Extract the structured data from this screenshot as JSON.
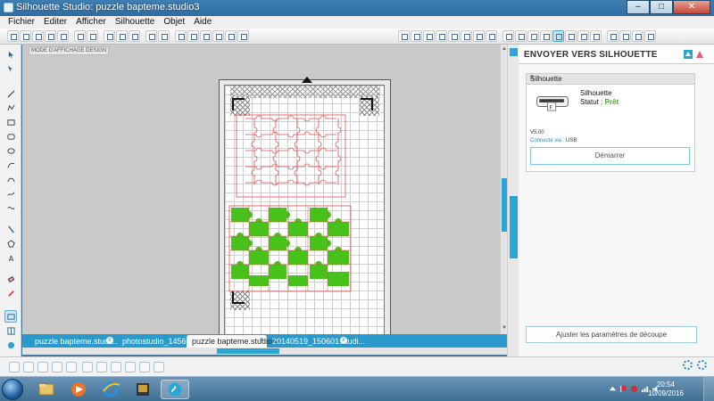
{
  "window": {
    "title": "Silhouette Studio: puzzle bapteme.studio3",
    "minimize": "–",
    "maximize": "□",
    "close": "✕"
  },
  "menu": [
    "Fichier",
    "Editer",
    "Afficher",
    "Silhouette",
    "Objet",
    "Aide"
  ],
  "canvas": {
    "mode_label": "MODE D'AFFICHAGE DESIGN"
  },
  "tabs": [
    {
      "label": "puzzle bapteme.studi...",
      "active": false
    },
    {
      "label": "photostudio_145644...",
      "active": false
    },
    {
      "label": "puzzle bapteme.studio3",
      "active": true
    },
    {
      "label": "20140519_150601.studi...",
      "active": false
    }
  ],
  "panel": {
    "title": "ENVOYER VERS SILHOUETTE",
    "device_section": "Silhouette",
    "device_name": "Silhouette",
    "status_label": "Statut : ",
    "status_value": "Prêt",
    "version": "V5.00",
    "connection_label": "Connecté via : ",
    "connection_value": "USB",
    "start_button": "Démarrer",
    "adjust_button": "Ajuster les paramètres de découpe",
    "pause_symbol": "II",
    "cutter_letter": "F"
  },
  "taskbar": {
    "time": "20:54",
    "date": "10/09/2016"
  },
  "colors": {
    "accent": "#2aa6d6",
    "puzzle_outline": "#e04b4b",
    "puzzle_fill": "#47c21a",
    "status_ready": "#3fae2a"
  }
}
